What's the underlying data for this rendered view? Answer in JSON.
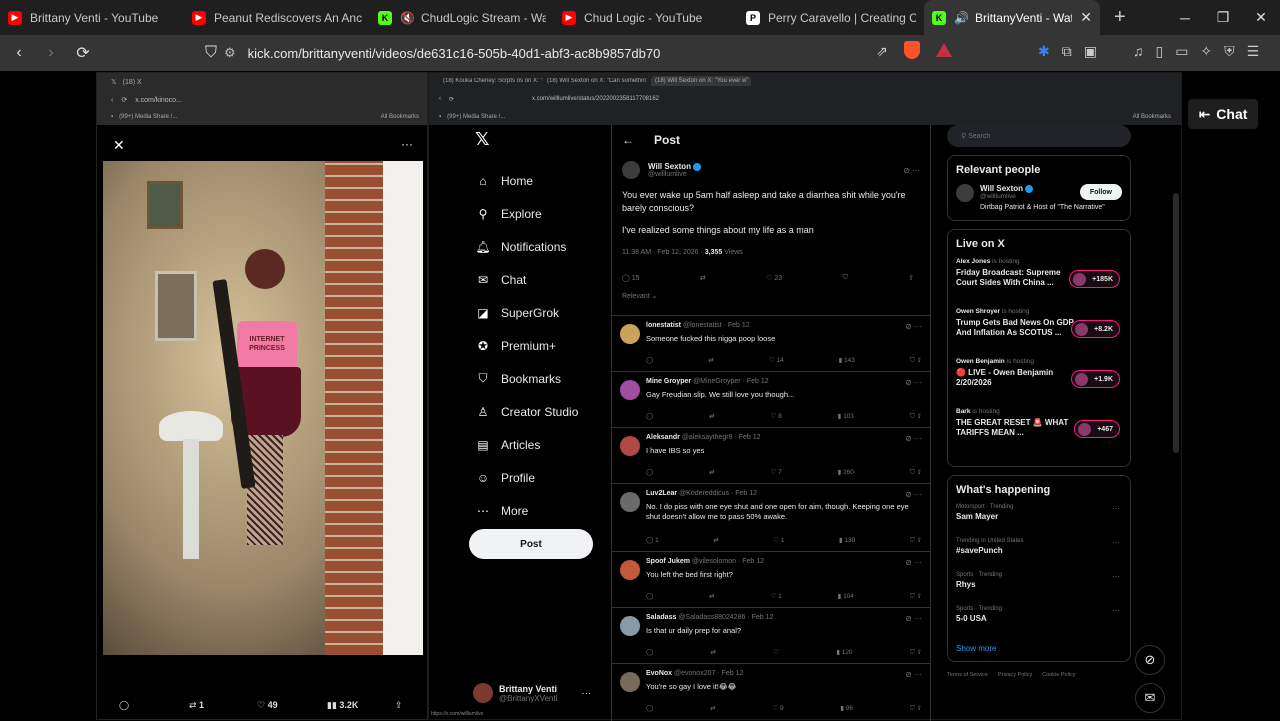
{
  "browser": {
    "tabs": [
      {
        "title": "Brittany Venti - YouTube",
        "icon": "youtube-icon"
      },
      {
        "title": "Peanut Rediscovers An Ancient",
        "icon": "youtube-icon"
      },
      {
        "title": "ChudLogic Stream - Watch L",
        "icon": "kick-icon"
      },
      {
        "title": "Chud Logic - YouTube",
        "icon": "youtube-icon"
      },
      {
        "title": "Perry Caravello | Creating Come",
        "icon": "patreon-icon"
      },
      {
        "title": "BrittanyVenti - Watch the",
        "icon": "kick-icon",
        "active": true
      }
    ],
    "url": "kick.com/brittanyventi/videos/de631c16-505b-40d1-abf3-ac8b9857db70"
  },
  "phone": {
    "tab_title": "(18) X",
    "url": "x.com/kinoco...",
    "bookmark": "(99+) Media Share /...",
    "bookmarks_all": "All Bookmarks",
    "shirt_text": "INTERNET PRINCESS",
    "actions": {
      "retweets": "1",
      "likes": "49",
      "views": "3.2K"
    }
  },
  "x": {
    "tabs": [
      "(18) Kouka Cheney: Scrpts os on X: \"Can somethin\"",
      "(18) Will Sexton on X: \"Can somethin\"",
      "(18) Will Sexton on X: \"You ever w\""
    ],
    "url": "x.com/willlumlive/status/2022002358117708162",
    "bookmark": "(99+) Media Share /...",
    "bookmarks_all": "All Bookmarks",
    "nav": [
      {
        "label": "Home",
        "icon": "home-icon"
      },
      {
        "label": "Explore",
        "icon": "search-icon"
      },
      {
        "label": "Notifications",
        "icon": "bell-icon"
      },
      {
        "label": "Chat",
        "icon": "chat-icon"
      },
      {
        "label": "SuperGrok",
        "icon": "grok-icon"
      },
      {
        "label": "Premium+",
        "icon": "premium-icon"
      },
      {
        "label": "Bookmarks",
        "icon": "bookmark-icon"
      },
      {
        "label": "Creator Studio",
        "icon": "creator-icon"
      },
      {
        "label": "Articles",
        "icon": "articles-icon"
      },
      {
        "label": "Profile",
        "icon": "profile-icon"
      },
      {
        "label": "More",
        "icon": "more-icon"
      }
    ],
    "post_button": "Post",
    "account": {
      "name": "Brittany Venti",
      "handle": "@BrittanyXVenti"
    },
    "status_url": "https://x.com/willlumlive",
    "post_header": "Post",
    "main_post": {
      "name": "Will Sexton",
      "handle": "@willlumlive",
      "text1": "You ever wake up 5am half asleep and take a diarrhea shit while you're barely conscious?",
      "text2": "I've realized some things about my life as a man",
      "time": "11:38 AM · Feb 12, 2026 · ",
      "views_num": "3,355",
      "views_label": " Views",
      "replies": "15",
      "likes": "23",
      "sort": "Relevant"
    },
    "replies": [
      {
        "name": "lonestatist",
        "handle": "@lonestatist · Feb 12",
        "text": "Someone fucked this nigga poop loose",
        "replies": "",
        "likes": "14",
        "views": "143",
        "color": "#c9a35a"
      },
      {
        "name": "Mine Groyper",
        "handle": "@MineGroyper · Feb 12",
        "text": "Gay Freudian slip. We still love you though...",
        "replies": "",
        "likes": "8",
        "views": "103",
        "color": "#a04ea0"
      },
      {
        "name": "Aleksandr",
        "handle": "@aleksaythegr8 · Feb 12",
        "text": "I have IBS so yes",
        "replies": "",
        "likes": "7",
        "views": "260",
        "color": "#b04848"
      },
      {
        "name": "Luv2Lear",
        "handle": "@Kodereddicus · Feb 12",
        "text": "No. I do piss with one eye shut and one open for aim, though. Keeping one eye shut doesn't allow me to pass 50% awake.",
        "replies": "1",
        "likes": "1",
        "views": "130",
        "color": "#6a6a6a"
      },
      {
        "name": "Spoof Jukem",
        "handle": "@vilesolomon · Feb 12",
        "text": "You left the bed first right?",
        "replies": "",
        "likes": "1",
        "views": "104",
        "color": "#c05a3a"
      },
      {
        "name": "Saladass",
        "handle": "@Saladass88024286 · Feb 12",
        "text": "Is that ur daily prep for anal?",
        "replies": "",
        "likes": "",
        "views": "120",
        "color": "#8899aa"
      },
      {
        "name": "EvoNox",
        "handle": "@evonox207 · Feb 12",
        "text": "You're so gay I love it!😂😂",
        "replies": "",
        "likes": "9",
        "views": "96",
        "color": "#7a6a5a"
      }
    ],
    "search_placeholder": "Search",
    "relevant_people": {
      "title": "Relevant people",
      "name": "Will Sexton",
      "handle": "@willlumlive",
      "bio": "Dirtbag Patriot & Host of \"The Narrative\"",
      "follow": "Follow"
    },
    "live": {
      "title": "Live on X",
      "items": [
        {
          "host": "Alex Jones",
          "status": " is hosting",
          "title": "Friday Broadcast: Supreme Court Sides With China ...",
          "count": "+185K"
        },
        {
          "host": "Owen Shroyer",
          "status": " is hosting",
          "title": "Trump Gets Bad News On GDP And Inflation As SCOTUS ...",
          "count": "+8.2K"
        },
        {
          "host": "Owen Benjamin",
          "status": " is hosting",
          "title": "🔴 LIVE - Owen Benjamin 2/20/2026",
          "count": "+1.9K"
        },
        {
          "host": "Bark",
          "status": " is hosting",
          "title": "THE GREAT RESET 🚨 WHAT TARIFFS MEAN ...",
          "count": "+467"
        }
      ]
    },
    "happening": {
      "title": "What's happening",
      "items": [
        {
          "cat": "Motorsport · Trending",
          "name": "Sam Mayer"
        },
        {
          "cat": "Trending in United States",
          "name": "#savePunch"
        },
        {
          "cat": "Sports · Trending",
          "name": "Rhys"
        },
        {
          "cat": "Sports · Trending",
          "name": "5-0 USA"
        }
      ],
      "show_more": "Show more"
    },
    "footer": [
      "Terms of Service",
      "Privacy Policy",
      "Cookie Policy"
    ]
  },
  "kick": {
    "chat_label": "Chat"
  }
}
